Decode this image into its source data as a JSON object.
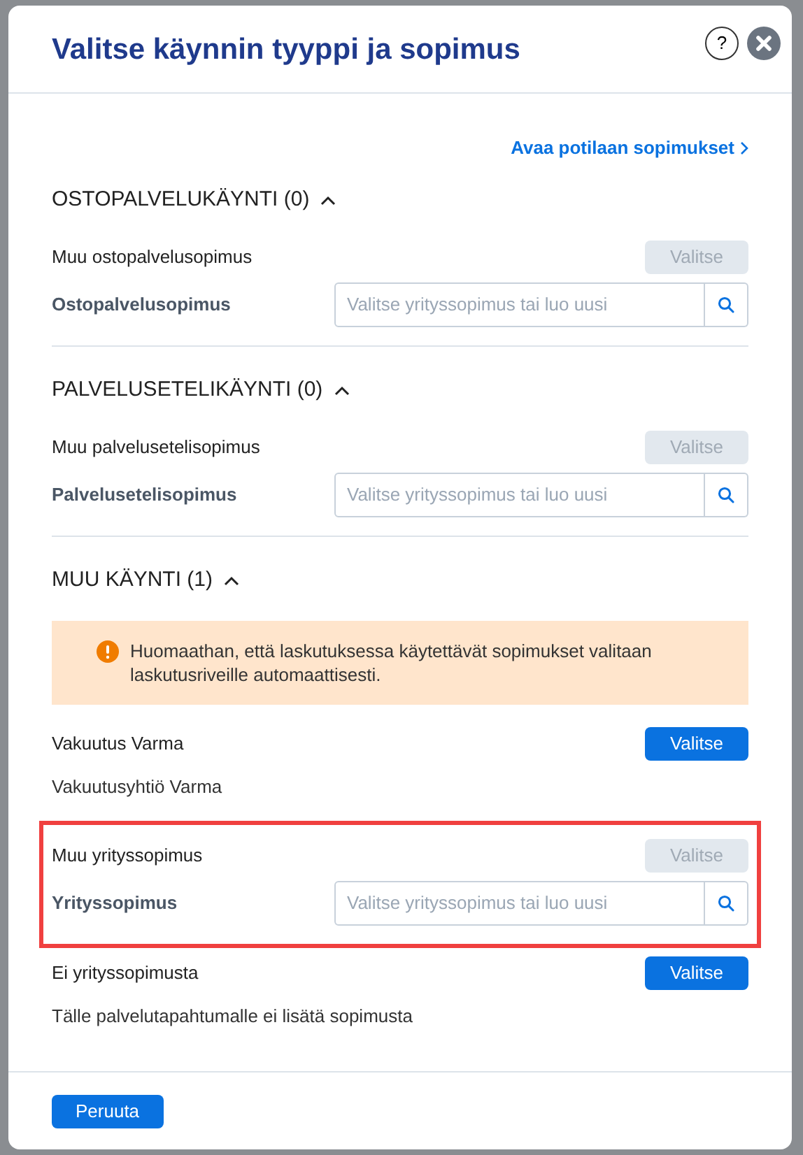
{
  "dialog": {
    "title": "Valitse käynnin tyyppi ja sopimus",
    "help_button": "?",
    "link": "Avaa potilaan sopimukset"
  },
  "sections": [
    {
      "title": "OSTOPALVELUKÄYNTI (0)",
      "expanded": true,
      "items": [
        {
          "kind": "contract",
          "name": "Muu ostopalvelusopimus",
          "button": "Valitse",
          "disabled": true,
          "field_label": "Ostopalvelusopimus",
          "placeholder": "Valitse yrityssopimus tai luo uusi",
          "highlighted": false
        }
      ]
    },
    {
      "title": "PALVELUSETELIKÄYNTI (0)",
      "expanded": true,
      "items": [
        {
          "kind": "contract",
          "name": "Muu palvelusetelisopimus",
          "button": "Valitse",
          "disabled": true,
          "field_label": "Palvelusetelisopimus",
          "placeholder": "Valitse yrityssopimus tai luo uusi",
          "highlighted": false
        }
      ]
    },
    {
      "title": "MUU KÄYNTI (1)",
      "expanded": true,
      "items": [
        {
          "kind": "notice",
          "text": "Huomaathan, että laskutuksessa käytettävät sopimukset valitaan laskutusriveille automaattisesti."
        },
        {
          "kind": "option",
          "name": "Vakuutus Varma",
          "button": "Valitse",
          "disabled": false,
          "description": "Vakuutusyhtiö Varma"
        },
        {
          "kind": "contract",
          "name": "Muu yrityssopimus",
          "button": "Valitse",
          "disabled": true,
          "field_label": "Yrityssopimus",
          "placeholder": "Valitse yrityssopimus tai luo uusi",
          "highlighted": true
        },
        {
          "kind": "option",
          "name": "Ei yrityssopimusta",
          "button": "Valitse",
          "disabled": false,
          "description": "Tälle palvelutapahtumalle ei lisätä sopimusta"
        }
      ]
    }
  ],
  "footer": {
    "cancel_button": "Peruuta"
  }
}
